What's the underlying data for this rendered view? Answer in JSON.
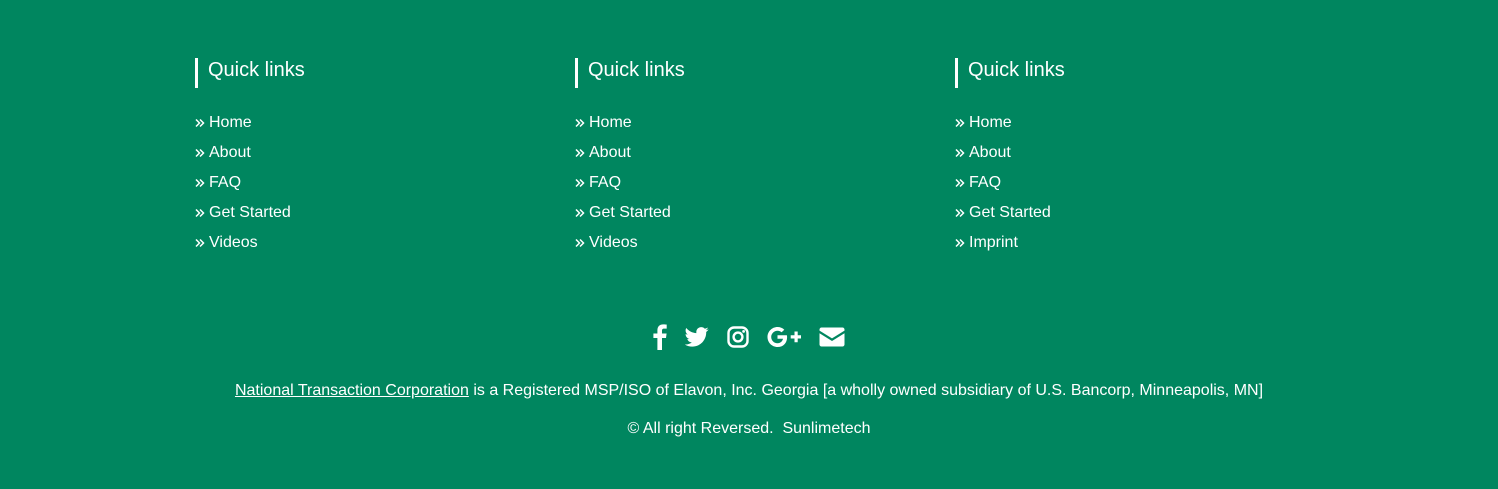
{
  "footer": {
    "columns": [
      {
        "title": "Quick links",
        "links": [
          {
            "label": "Home"
          },
          {
            "label": "About"
          },
          {
            "label": "FAQ"
          },
          {
            "label": "Get Started"
          },
          {
            "label": "Videos"
          }
        ]
      },
      {
        "title": "Quick links",
        "links": [
          {
            "label": "Home"
          },
          {
            "label": "About"
          },
          {
            "label": "FAQ"
          },
          {
            "label": "Get Started"
          },
          {
            "label": "Videos"
          }
        ]
      },
      {
        "title": "Quick links",
        "links": [
          {
            "label": "Home"
          },
          {
            "label": "About"
          },
          {
            "label": "FAQ"
          },
          {
            "label": "Get Started"
          },
          {
            "label": "Imprint"
          }
        ]
      }
    ],
    "social_icons": [
      "facebook-icon",
      "twitter-icon",
      "instagram-icon",
      "google-plus-icon",
      "email-icon"
    ],
    "legal": {
      "company_link": "National Transaction Corporation",
      "text": " is a Registered MSP/ISO of Elavon, Inc. Georgia [a wholly owned subsidiary of U.S. Bancorp, Minneapolis, MN]"
    },
    "copyright": "© All right Reversed.  Sunlimetech"
  },
  "colors": {
    "background": "#00865f",
    "text": "#ffffff"
  }
}
